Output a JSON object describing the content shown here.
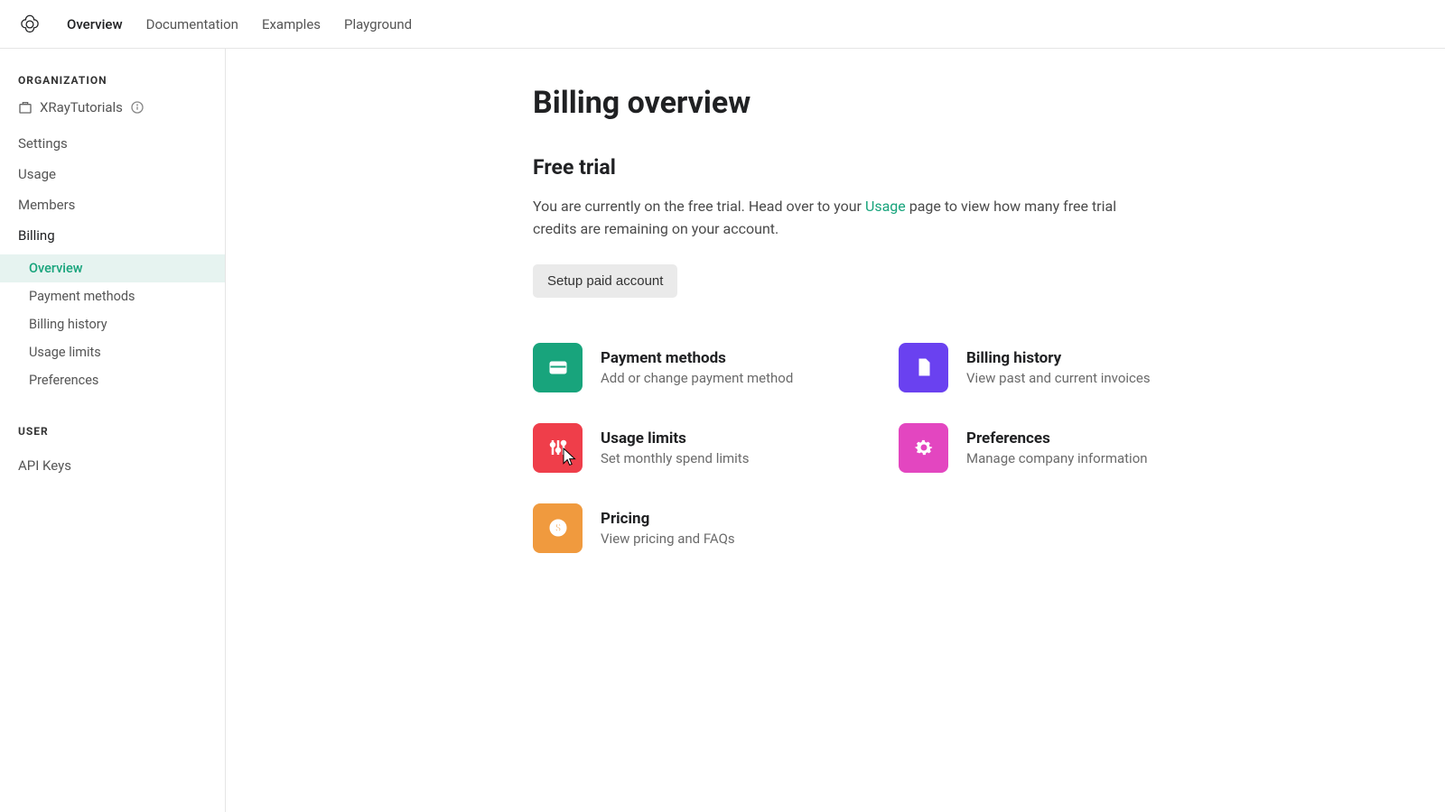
{
  "topnav": {
    "links": [
      "Overview",
      "Documentation",
      "Examples",
      "Playground"
    ]
  },
  "sidebar": {
    "org_label": "ORGANIZATION",
    "org_name": "XRayTutorials",
    "items": [
      "Settings",
      "Usage",
      "Members",
      "Billing"
    ],
    "billing_sub": [
      "Overview",
      "Payment methods",
      "Billing history",
      "Usage limits",
      "Preferences"
    ],
    "user_label": "USER",
    "user_items": [
      "API Keys"
    ]
  },
  "main": {
    "title": "Billing overview",
    "section_title": "Free trial",
    "trial_text_before": "You are currently on the free trial. Head over to your ",
    "trial_link": "Usage",
    "trial_text_after": " page to view how many free trial credits are remaining on your account.",
    "setup_button": "Setup paid account",
    "cards": [
      {
        "title": "Payment methods",
        "desc": "Add or change payment method",
        "color": "#18a47c",
        "icon": "card"
      },
      {
        "title": "Billing history",
        "desc": "View past and current invoices",
        "color": "#6a41f0",
        "icon": "doc"
      },
      {
        "title": "Usage limits",
        "desc": "Set monthly spend limits",
        "color": "#ef3e4a",
        "icon": "sliders"
      },
      {
        "title": "Preferences",
        "desc": "Manage company information",
        "color": "#e346c0",
        "icon": "gear"
      },
      {
        "title": "Pricing",
        "desc": "View pricing and FAQs",
        "color": "#f09a3e",
        "icon": "dollar"
      }
    ]
  }
}
